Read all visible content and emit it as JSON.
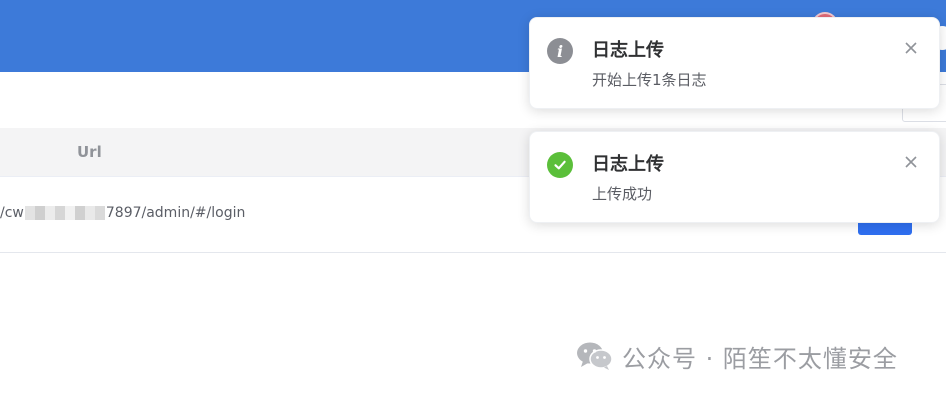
{
  "table": {
    "headers": {
      "url": "Url"
    },
    "rows": [
      {
        "url_prefix": "/cw",
        "url_suffix": "7897/admin/#/login"
      }
    ]
  },
  "notifications": [
    {
      "type": "info",
      "icon": "info-icon",
      "title": "日志上传",
      "message": "开始上传1条日志"
    },
    {
      "type": "success",
      "icon": "check-icon",
      "title": "日志上传",
      "message": "上传成功"
    }
  ],
  "watermark": {
    "text": "公众号 · 陌笙不太懂安全"
  },
  "colors": {
    "header_bg": "#3d7ad9",
    "success": "#5bbf3a",
    "info": "#8c8e94",
    "primary_button": "#2f6ff0"
  }
}
